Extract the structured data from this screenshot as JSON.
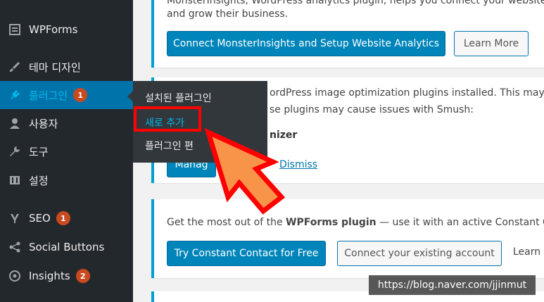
{
  "sidebar": {
    "items": [
      {
        "label": "WPForms",
        "icon": "form-icon"
      },
      {
        "label": "테마 디자인",
        "icon": "paintbrush-icon"
      },
      {
        "label": "플러그인",
        "icon": "plugin-icon",
        "badge": "1"
      },
      {
        "label": "사용자",
        "icon": "user-icon"
      },
      {
        "label": "도구",
        "icon": "wrench-icon"
      },
      {
        "label": "설정",
        "icon": "settings-icon"
      },
      {
        "label": "SEO",
        "icon": "seo-icon",
        "badge": "1"
      },
      {
        "label": "Social Buttons",
        "icon": "share-icon"
      },
      {
        "label": "Insights",
        "icon": "insights-icon",
        "badge": "2"
      }
    ],
    "submenu": [
      "설치된 플러그인",
      "새로 추가",
      "플러그인 편"
    ]
  },
  "notice1": {
    "line1": "MonsterInsights, WordPress analytics plugin, helps you connect your website w",
    "line2": "and grow their business.",
    "primary_button": "Connect MonsterInsights and Setup Website Analytics",
    "secondary_button": "Learn More"
  },
  "notice2": {
    "line1": "ordPress image optimization plugins installed. This may ca",
    "line2": "se plugins may cause issues with Smush:",
    "plugin_name": "nizer",
    "button": "Manag",
    "dismiss": "Dismiss"
  },
  "notice3": {
    "text_before": "Get the most out of the ",
    "text_bold": "WPForms plugin",
    "text_after": " — use it with an active Constant Con",
    "primary_button": "Try Constant Contact for Free",
    "secondary_button": "Connect your existing account",
    "learn": "Learn M"
  },
  "watermark": "https://blog.naver.com/jjinmut",
  "colors": {
    "sidebar": "#23282d",
    "accent": "#0073aa",
    "highlight": "#ff0000",
    "arrow": "#f7944a"
  }
}
